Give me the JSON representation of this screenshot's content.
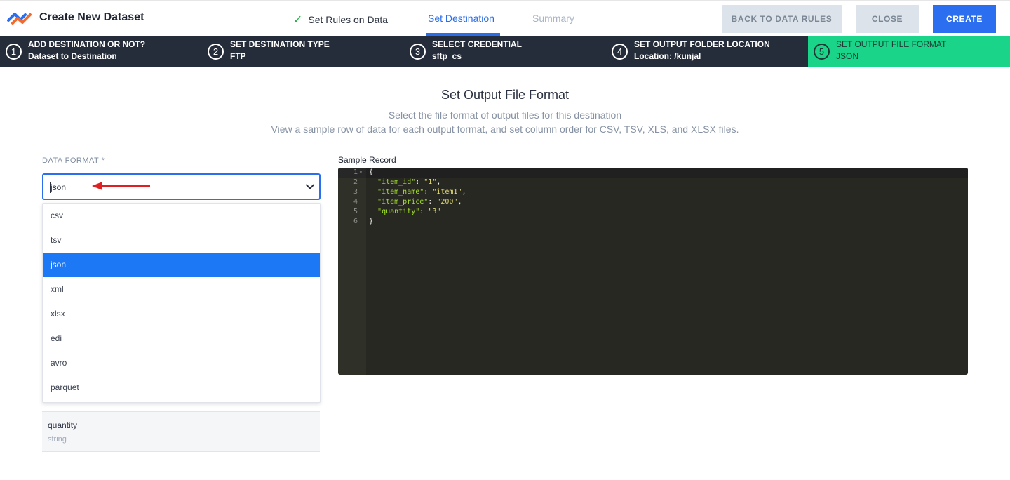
{
  "header": {
    "app_title": "Create New Dataset",
    "tabs": [
      {
        "label": "Set Rules on Data",
        "state": "done"
      },
      {
        "label": "Set Destination",
        "state": "active"
      },
      {
        "label": "Summary",
        "state": "pending"
      }
    ],
    "buttons": {
      "back": "BACK TO DATA RULES",
      "close": "CLOSE",
      "create": "CREATE"
    }
  },
  "steps": [
    {
      "num": "1",
      "title": "ADD DESTINATION OR NOT?",
      "sub": "Dataset to Destination"
    },
    {
      "num": "2",
      "title": "SET DESTINATION TYPE",
      "sub": "FTP"
    },
    {
      "num": "3",
      "title": "SELECT CREDENTIAL",
      "sub": "sftp_cs"
    },
    {
      "num": "4",
      "title": "SET OUTPUT FOLDER LOCATION",
      "sub": "Location: /kunjal"
    },
    {
      "num": "5",
      "title": "SET OUTPUT FILE FORMAT",
      "sub": "JSON"
    }
  ],
  "main": {
    "heading": "Set Output File Format",
    "desc1": "Select the file format of output files for this destination",
    "desc2": "View a sample row of data for each output format, and set column order for CSV, TSV, XLS, and XLSX files.",
    "format_label": "DATA FORMAT *",
    "format_value": "json",
    "format_options": [
      "csv",
      "tsv",
      "json",
      "xml",
      "xlsx",
      "edi",
      "avro",
      "parquet"
    ],
    "selected_option": "json",
    "column": {
      "name": "quantity",
      "type": "string"
    },
    "sample_label": "Sample Record",
    "code_lines": [
      {
        "n": "1",
        "text": "{"
      },
      {
        "n": "2",
        "key": "\"item_id\"",
        "val": "\"1\"",
        "tail": ","
      },
      {
        "n": "3",
        "key": "\"item_name\"",
        "val": "\"item1\"",
        "tail": ","
      },
      {
        "n": "4",
        "key": "\"item_price\"",
        "val": "\"200\"",
        "tail": ","
      },
      {
        "n": "5",
        "key": "\"quantity\"",
        "val": "\"3\"",
        "tail": ""
      },
      {
        "n": "6",
        "text": "}"
      }
    ]
  },
  "colors": {
    "accent": "#2b6ff0",
    "active_step": "#19d489",
    "stepbar": "#262d3a",
    "editor_bg": "#272822"
  }
}
